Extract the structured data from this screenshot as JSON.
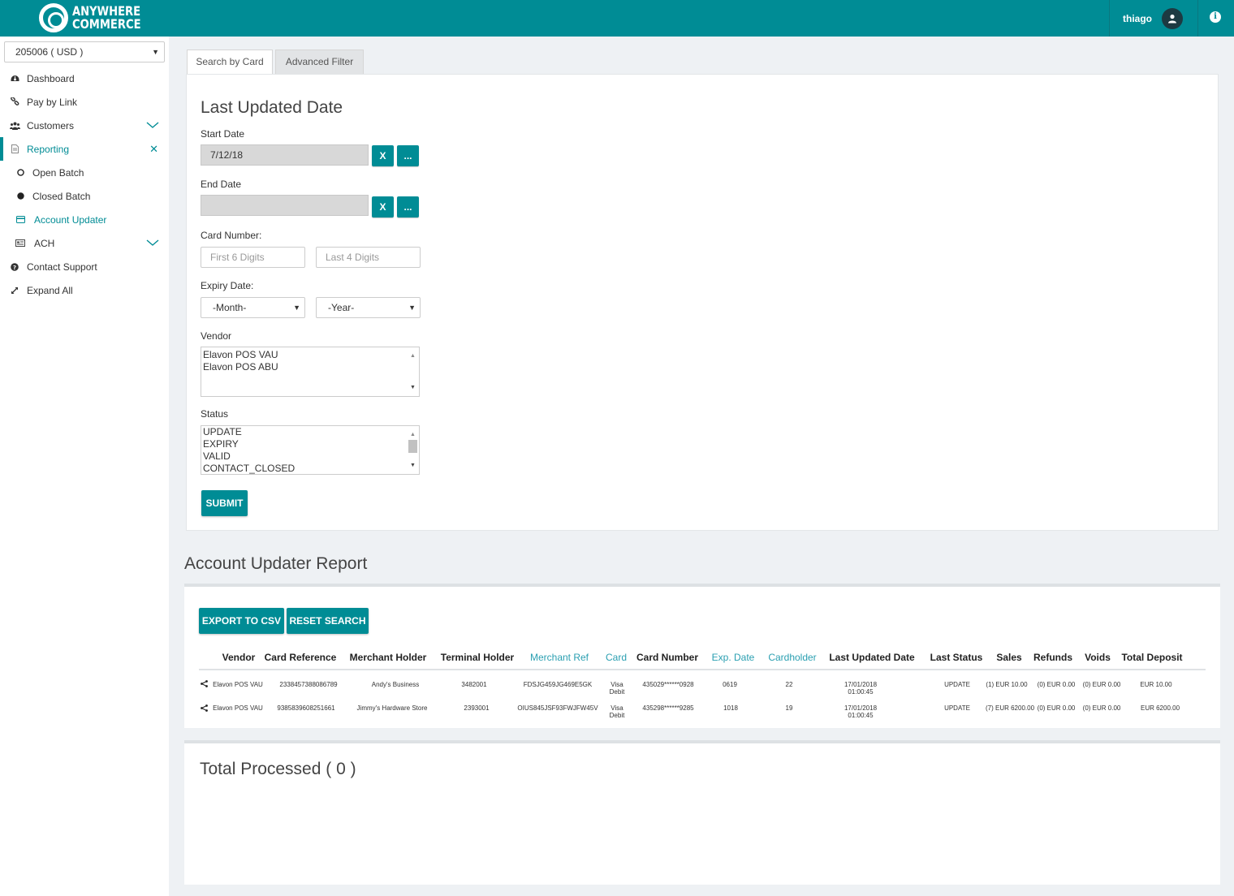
{
  "brand": {
    "line1": "ANYWHERE",
    "line2": "COMMERCE",
    "color": "#008c95"
  },
  "user": {
    "name": "thiago"
  },
  "sidebar": {
    "currency": "205006 ( USD )",
    "items": [
      {
        "label": "Dashboard",
        "icon": "dashboard-icon"
      },
      {
        "label": "Pay by Link",
        "icon": "link-icon"
      },
      {
        "label": "Customers",
        "icon": "users-icon"
      },
      {
        "label": "Reporting",
        "icon": "document-icon"
      },
      {
        "label": "Open Batch",
        "icon": "open-circle-icon"
      },
      {
        "label": "Closed Batch",
        "icon": "filled-circle-icon"
      },
      {
        "label": "Account Updater",
        "icon": "card-icon"
      },
      {
        "label": "ACH",
        "icon": "bank-check-icon"
      },
      {
        "label": "Contact Support",
        "icon": "question-icon"
      },
      {
        "label": "Expand All",
        "icon": "expand-icon"
      }
    ]
  },
  "tabs": {
    "search_by_card": "Search by Card",
    "advanced_filter": "Advanced Filter"
  },
  "filter": {
    "section_title": "Last Updated Date",
    "start_label": "Start Date",
    "start_value": "7/12/18",
    "end_label": "End Date",
    "end_value": "",
    "clear_label": "X",
    "picker_label": "...",
    "card_number_label": "Card Number:",
    "first6_placeholder": "First 6 Digits",
    "last4_placeholder": "Last 4 Digits",
    "expiry_label": "Expiry Date:",
    "month_value": "-Month-",
    "year_value": "-Year-",
    "vendor_label": "Vendor",
    "vendor_options": [
      "Elavon POS VAU",
      "Elavon POS ABU"
    ],
    "status_label": "Status",
    "status_options": [
      "UPDATE",
      "EXPIRY",
      "VALID",
      "CONTACT_CLOSED"
    ],
    "submit_label": "SUBMIT"
  },
  "report": {
    "title": "Account Updater Report",
    "export_label": "EXPORT TO CSV",
    "reset_label": "RESET SEARCH",
    "columns": [
      "Vendor",
      "Card Reference",
      "Merchant Holder",
      "Terminal Holder",
      "Merchant Ref",
      "Card",
      "Card Number",
      "Exp. Date",
      "Cardholder",
      "Last Updated Date",
      "Last Status",
      "Sales",
      "Refunds",
      "Voids",
      "Total Deposit"
    ],
    "rows": [
      {
        "vendor": "Elavon POS VAU",
        "card_reference": "2338457388086789",
        "merchant_holder": "Andy's Business",
        "terminal_holder": "3482001",
        "merchant_ref": "FDSJG459JG469E5GK",
        "card_line1": "Visa",
        "card_line2": "Debit",
        "card_number": "435029******0928",
        "exp_date": "0619",
        "cardholder": "22",
        "updated_line1": "17/01/2018",
        "updated_line2": "01:00:45",
        "last_status": "UPDATE",
        "sales": "(1) EUR 10.00",
        "refunds": "(0) EUR 0.00",
        "voids": "(0) EUR 0.00",
        "total_deposit": "EUR 10.00"
      },
      {
        "vendor": "Elavon POS VAU",
        "card_reference": "9385839608251661",
        "merchant_holder": "Jimmy's Hardware Store",
        "terminal_holder": "2393001",
        "merchant_ref": "OIUS845JSF93FWJFW45V",
        "card_line1": "Visa",
        "card_line2": "Debit",
        "card_number": "435298******9285",
        "exp_date": "1018",
        "cardholder": "19",
        "updated_line1": "17/01/2018",
        "updated_line2": "01:00:45",
        "last_status": "UPDATE",
        "sales": "(7) EUR 6200.00",
        "refunds": "(0) EUR 0.00",
        "voids": "(0) EUR 0.00",
        "total_deposit": "EUR 6200.00"
      }
    ]
  },
  "total": {
    "title": "Total Processed ( 0 )"
  }
}
